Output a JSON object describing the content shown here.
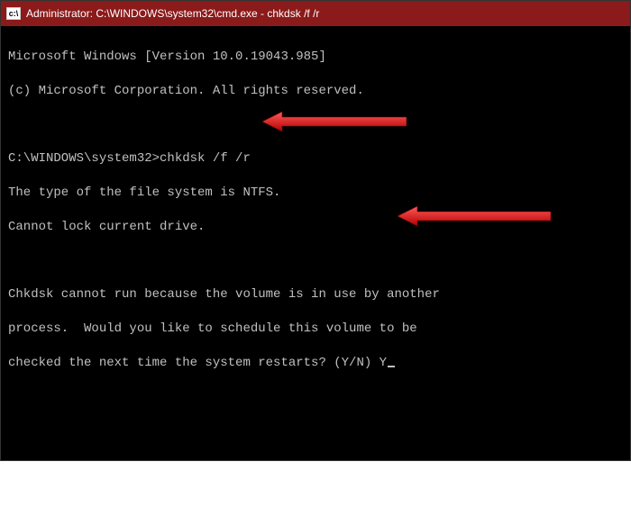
{
  "title_bar": {
    "icon_label": "C:\\",
    "title": "Administrator: C:\\WINDOWS\\system32\\cmd.exe - chkdsk  /f /r"
  },
  "terminal": {
    "version_line": "Microsoft Windows [Version 10.0.19043.985]",
    "copyright_line": "(c) Microsoft Corporation. All rights reserved.",
    "prompt": "C:\\WINDOWS\\system32>",
    "command": "chkdsk /f /r",
    "fs_type_line": "The type of the file system is NTFS.",
    "lock_line": "Cannot lock current drive.",
    "msg_line1": "Chkdsk cannot run because the volume is in use by another",
    "msg_line2": "process.  Would you like to schedule this volume to be",
    "msg_line3_prefix": "checked the next time the system restarts? (Y/N) ",
    "response": "Y"
  },
  "annotations": {
    "arrow1_target": "command-input-area",
    "arrow2_target": "response-y"
  }
}
